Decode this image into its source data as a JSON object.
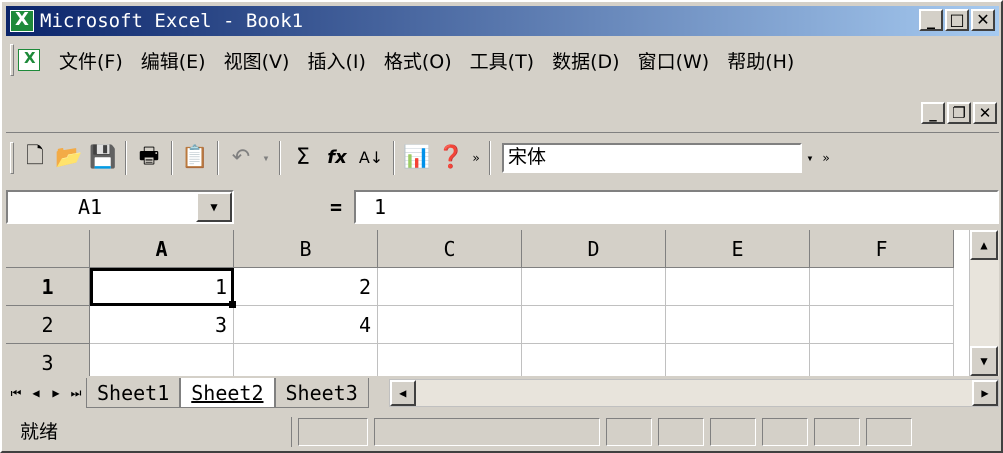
{
  "titlebar": {
    "title": "Microsoft Excel - Book1"
  },
  "menu": [
    "文件(F)",
    "编辑(E)",
    "视图(V)",
    "插入(I)",
    "格式(O)",
    "工具(T)",
    "数据(D)",
    "窗口(W)",
    "帮助(H)"
  ],
  "toolbar": {
    "font_name": "宋体",
    "sum_label": "Σ",
    "fx_label": "fx"
  },
  "formula": {
    "name_box": "A1",
    "equals": "=",
    "value": "1"
  },
  "columns": [
    "A",
    "B",
    "C",
    "D",
    "E",
    "F"
  ],
  "rows": [
    {
      "header": "1",
      "cells": [
        "1",
        "2",
        "",
        "",
        "",
        ""
      ]
    },
    {
      "header": "2",
      "cells": [
        "3",
        "4",
        "",
        "",
        "",
        ""
      ]
    },
    {
      "header": "3",
      "cells": [
        "",
        "",
        "",
        "",
        "",
        ""
      ]
    }
  ],
  "sheets": [
    "Sheet1",
    "Sheet2",
    "Sheet3"
  ],
  "active_sheet": "Sheet2",
  "status": {
    "text": "就绪"
  }
}
